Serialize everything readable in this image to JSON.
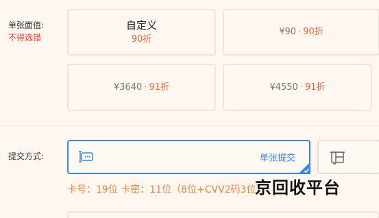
{
  "face_value": {
    "label": "单张面值:",
    "note": "不得选错",
    "cards": [
      {
        "title": "自定义",
        "discount": "90折"
      },
      {
        "amount": "¥90",
        "sep": "·",
        "rate": "90折"
      },
      {
        "amount": "¥3640",
        "sep": "·",
        "rate": "91折"
      },
      {
        "amount": "¥4550",
        "sep": "·",
        "rate": "91折"
      }
    ]
  },
  "submit_method": {
    "label": "提交方式:",
    "options": [
      {
        "label": "单张提交",
        "icon": "card-input-icon",
        "selected": true
      },
      {
        "label": "",
        "icon": "batch-submit-icon",
        "selected": false
      }
    ]
  },
  "hint": "卡号：19位 卡密：11位（8位+CVV2码3位）",
  "watermark": "京回收平台",
  "colors": {
    "accent": "#3b86e0",
    "discount": "#e8663c",
    "note": "#e8453c"
  }
}
